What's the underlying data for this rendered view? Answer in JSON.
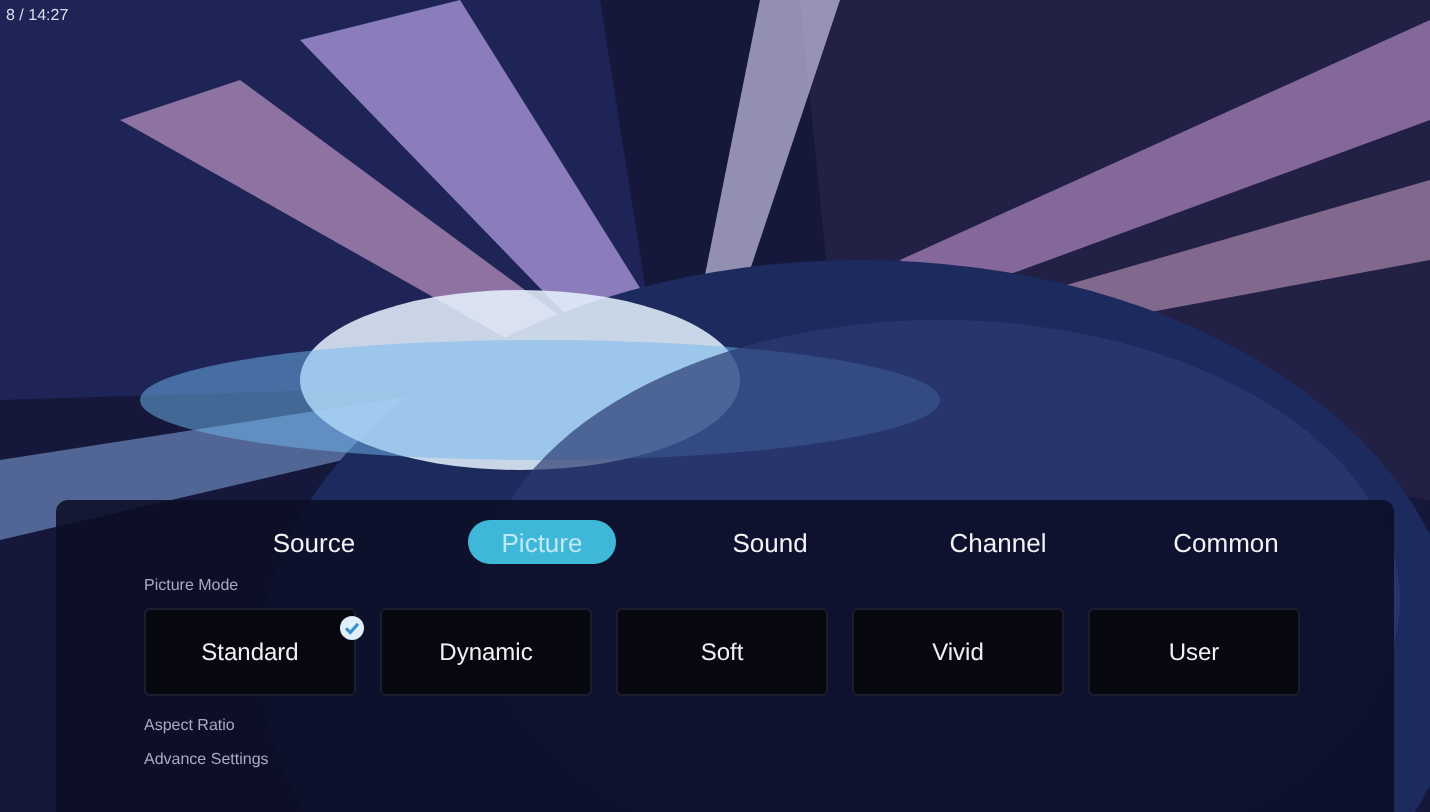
{
  "status": {
    "text": "8 / 14:27"
  },
  "tabs": [
    {
      "label": "Source",
      "selected": false
    },
    {
      "label": "Picture",
      "selected": true
    },
    {
      "label": "Sound",
      "selected": false
    },
    {
      "label": "Channel",
      "selected": false
    },
    {
      "label": "Common",
      "selected": false
    }
  ],
  "picture_mode": {
    "label": "Picture Mode",
    "options": [
      {
        "label": "Standard",
        "selected": true
      },
      {
        "label": "Dynamic",
        "selected": false
      },
      {
        "label": "Soft",
        "selected": false
      },
      {
        "label": "Vivid",
        "selected": false
      },
      {
        "label": "User",
        "selected": false
      }
    ]
  },
  "settings": [
    {
      "label": "Aspect Ratio"
    },
    {
      "label": "Advance Settings"
    }
  ]
}
